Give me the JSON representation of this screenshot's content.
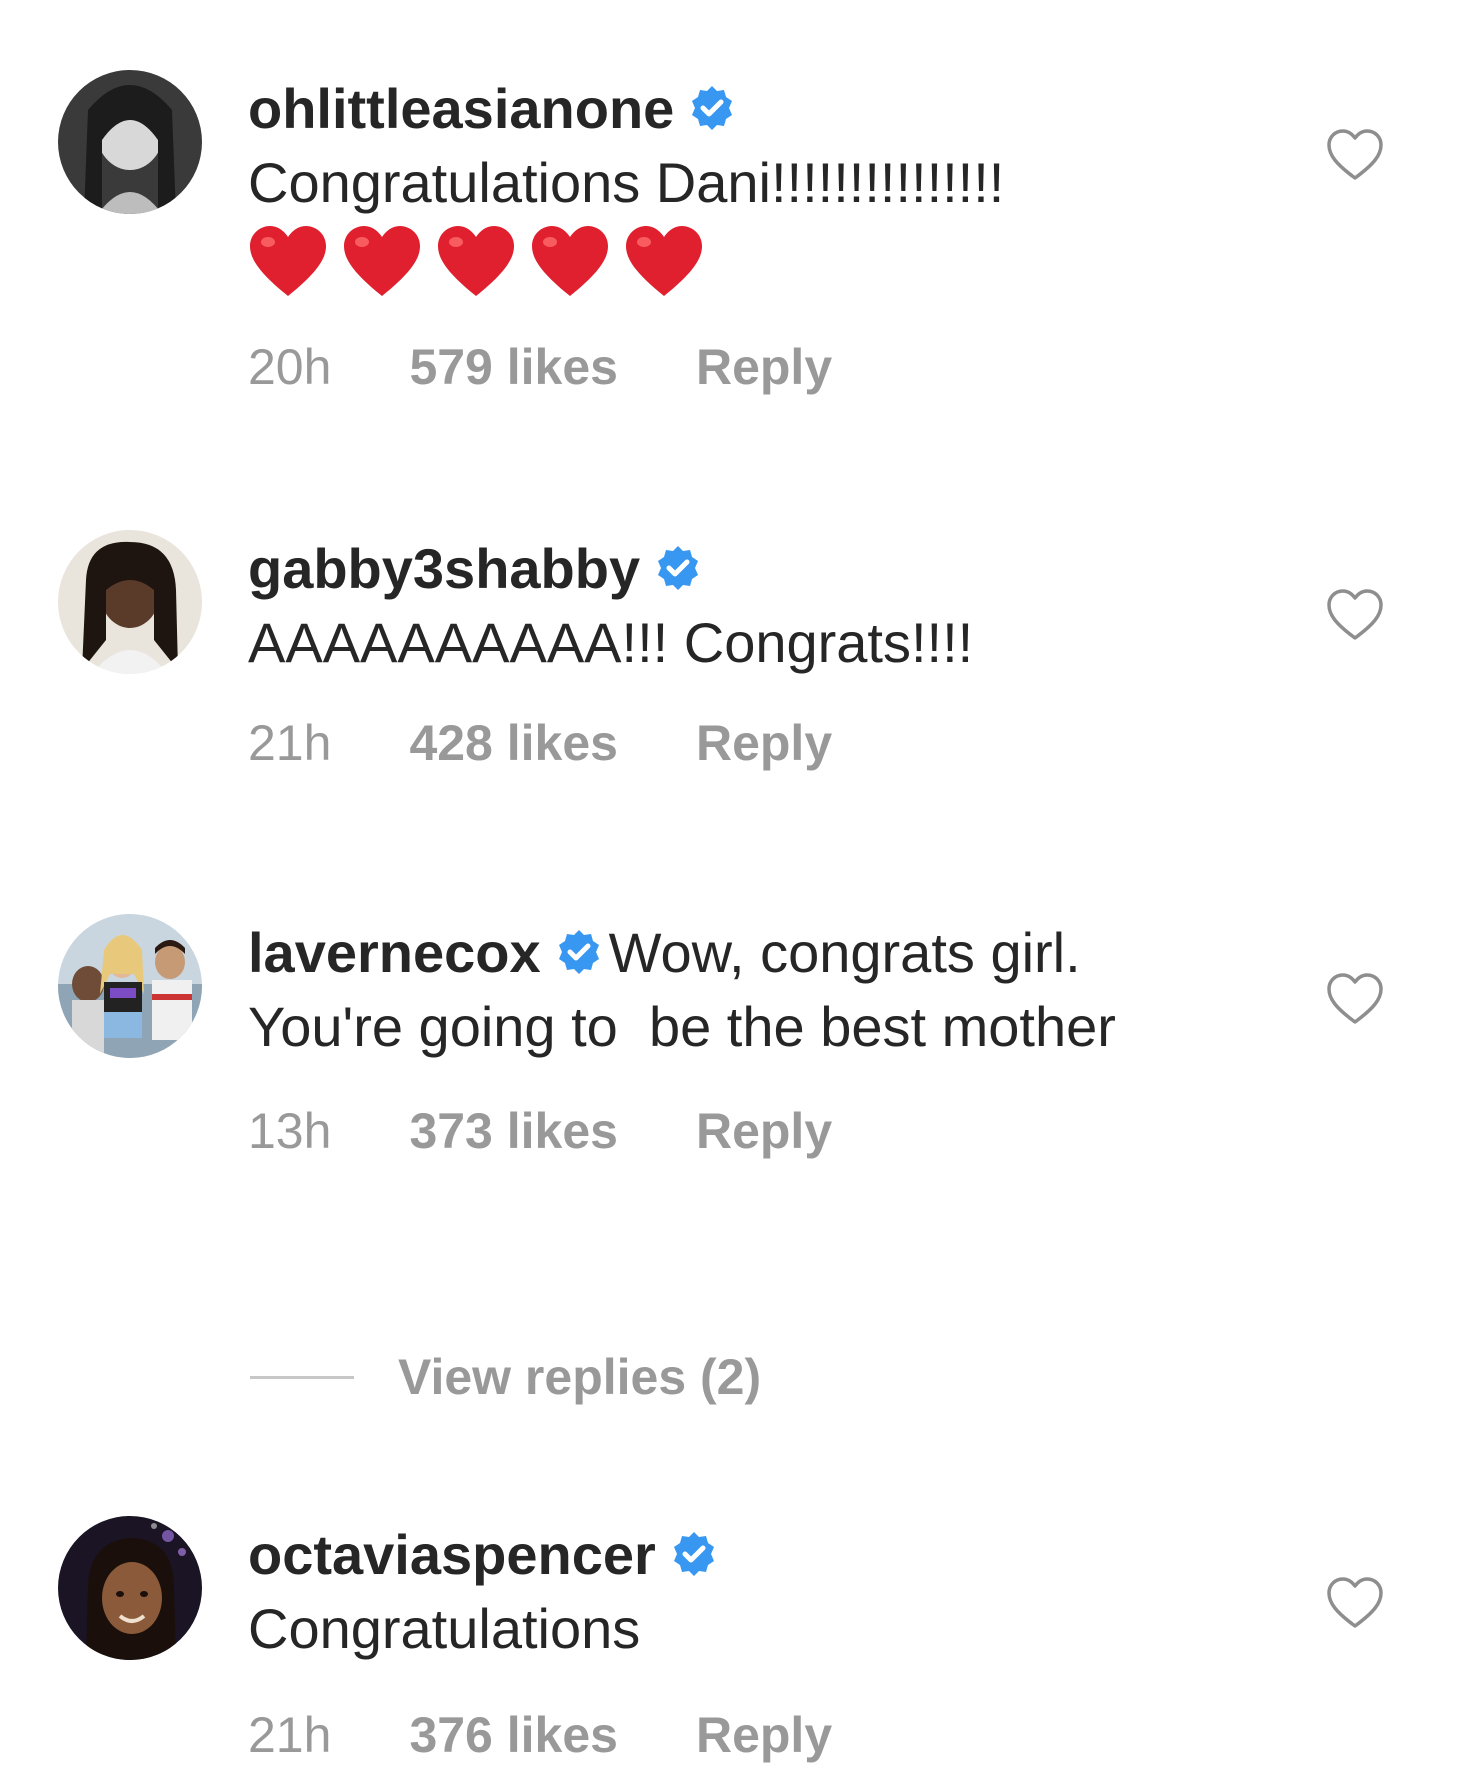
{
  "colors": {
    "text": "#262626",
    "secondary": "#999999",
    "verified": "#3897f0",
    "heart_emoji": "#e0202e"
  },
  "comments": [
    {
      "username": "ohlittleasianone",
      "verified": true,
      "text": "Congratulations Dani!!!!!!!!!!!!!!!",
      "emoji": [
        "heart",
        "heart",
        "heart",
        "heart",
        "heart"
      ],
      "time": "20h",
      "likes": "579 likes",
      "reply": "Reply",
      "avatar_icon": "avatar-photo"
    },
    {
      "username": "gabby3shabby",
      "verified": true,
      "text": "AAAAAAAAAA!!! Congrats!!!!",
      "time": "21h",
      "likes": "428 likes",
      "reply": "Reply",
      "avatar_icon": "avatar-photo"
    },
    {
      "username": "lavernecox",
      "verified": true,
      "text": "Wow, congrats girl. You're going to  be the best mother",
      "time": "13h",
      "likes": "373 likes",
      "reply": "Reply",
      "view_replies": "View replies (2)",
      "avatar_icon": "avatar-photo"
    },
    {
      "username": "octaviaspencer",
      "verified": true,
      "text": "Congratulations",
      "time": "21h",
      "likes": "376 likes",
      "reply": "Reply",
      "avatar_icon": "avatar-photo"
    }
  ],
  "icons": {
    "like": "heart-outline-icon",
    "verified": "verified-badge-icon"
  }
}
